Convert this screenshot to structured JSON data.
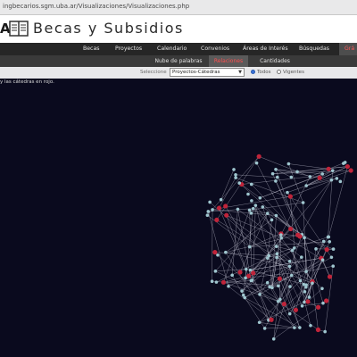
{
  "browser": {
    "url": "ingbecarios.sgm.uba.ar/Visualizaciones/Visualizaciones.php"
  },
  "header": {
    "logo_text": "A",
    "title": "Becas y Subsidios",
    "logo_icon": "book-scales-icon"
  },
  "main_nav": {
    "items": [
      "Becas",
      "Proyectos",
      "Calendario",
      "Convenios",
      "Áreas de Interés",
      "Búsquedas",
      "Grá"
    ],
    "active": "Grá"
  },
  "sub_nav": {
    "items": [
      "Nube de palabras",
      "Relaciones",
      "Cantidades"
    ],
    "active": "Relaciones"
  },
  "filter": {
    "label": "Seleccione",
    "selected": "Proyectos-Cátedras",
    "radio_all": "Todos",
    "radio_current": "Vigentes",
    "radio_checked": "Todos"
  },
  "caption": "y las cátedras en rojo.",
  "colors": {
    "background": "#0a0a1e",
    "node_project": "#9fc6cf",
    "node_chair": "#c0243a",
    "edge": "#d8d8e8",
    "nav_active_text": "#ff5b5b"
  }
}
